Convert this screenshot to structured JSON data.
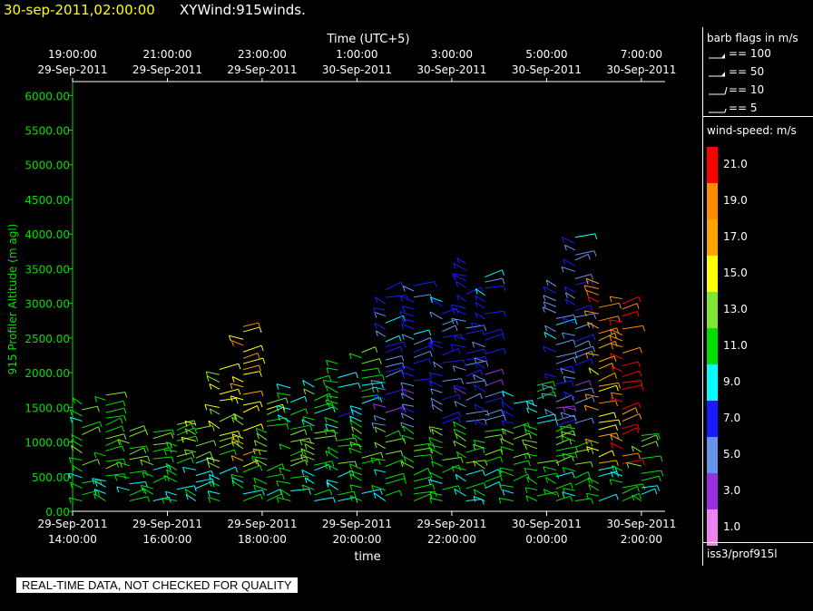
{
  "header": {
    "date_label": "30-sep-2011,02:00:00",
    "title": "XYWind:915winds."
  },
  "legend": {
    "barb_title": "barb flags in m/s",
    "barbs": [
      {
        "value": 100,
        "label": "== 100"
      },
      {
        "value": 50,
        "label": "== 50"
      },
      {
        "value": 10,
        "label": "== 10"
      },
      {
        "value": 5,
        "label": "== 5"
      }
    ],
    "speed_title": "wind-speed: m/s",
    "colorbar": [
      {
        "label": "21.0",
        "color": "#ff0000"
      },
      {
        "label": "19.0",
        "color": "#ff8c00"
      },
      {
        "label": "17.0",
        "color": "#ffa500"
      },
      {
        "label": "15.0",
        "color": "#ffff00"
      },
      {
        "label": "13.0",
        "color": "#7fe633"
      },
      {
        "label": "11.0",
        "color": "#00e000"
      },
      {
        "label": "9.0",
        "color": "#00ffff"
      },
      {
        "label": "7.0",
        "color": "#1a1aff"
      },
      {
        "label": "5.0",
        "color": "#6495ed"
      },
      {
        "label": "3.0",
        "color": "#9b30e0"
      },
      {
        "label": "1.0",
        "color": "#ee82ee"
      }
    ],
    "source": "iss3/prof915l"
  },
  "footer": {
    "quality_notice": "REAL-TIME DATA, NOT CHECKED FOR QUALITY"
  },
  "chart_data": {
    "type": "scatter",
    "subtype": "wind-barb time-height profile",
    "top_axis_title": "Time (UTC+5)",
    "xlabel": "time",
    "ylabel": "915 Profiler Altitude (m agl)",
    "x_range_hours": [
      14.0,
      26.5
    ],
    "ylim": [
      0,
      6200
    ],
    "y_ticks": [
      "0.00",
      "500.00",
      "1000.00",
      "1500.00",
      "2000.00",
      "2500.00",
      "3000.00",
      "3500.00",
      "4000.00",
      "4500.00",
      "5000.00",
      "5500.00",
      "6000.00"
    ],
    "x_ticks_bottom": [
      {
        "hour": 14,
        "line1": "29-Sep-2011",
        "line2": "14:00:00"
      },
      {
        "hour": 16,
        "line1": "29-Sep-2011",
        "line2": "16:00:00"
      },
      {
        "hour": 18,
        "line1": "29-Sep-2011",
        "line2": "18:00:00"
      },
      {
        "hour": 20,
        "line1": "29-Sep-2011",
        "line2": "20:00:00"
      },
      {
        "hour": 22,
        "line1": "29-Sep-2011",
        "line2": "22:00:00"
      },
      {
        "hour": 24,
        "line1": "30-Sep-2011",
        "line2": "0:00:00"
      },
      {
        "hour": 26,
        "line1": "30-Sep-2011",
        "line2": "2:00:00"
      }
    ],
    "x_ticks_top": [
      {
        "hour": 14,
        "line1": "19:00:00",
        "line2": "29-Sep-2011"
      },
      {
        "hour": 16,
        "line1": "21:00:00",
        "line2": "29-Sep-2011"
      },
      {
        "hour": 18,
        "line1": "23:00:00",
        "line2": "29-Sep-2011"
      },
      {
        "hour": 20,
        "line1": "1:00:00",
        "line2": "30-Sep-2011"
      },
      {
        "hour": 22,
        "line1": "3:00:00",
        "line2": "30-Sep-2011"
      },
      {
        "hour": 24,
        "line1": "5:00:00",
        "line2": "30-Sep-2011"
      },
      {
        "hour": 26,
        "line1": "7:00:00",
        "line2": "30-Sep-2011"
      }
    ],
    "axis_color": "#00e000",
    "profiles": [
      {
        "hour": 14.2,
        "top": 1600,
        "speed": 11
      },
      {
        "hour": 14.7,
        "top": 1700,
        "speed": 11
      },
      {
        "hour": 15.2,
        "top": 1250,
        "speed": 11
      },
      {
        "hour": 15.7,
        "top": 1200,
        "speed": 11
      },
      {
        "hour": 16.2,
        "top": 1300,
        "speed": 11
      },
      {
        "hour": 16.6,
        "top": 1300,
        "speed": 13
      },
      {
        "hour": 17.1,
        "top": 2100,
        "speed": 15
      },
      {
        "hour": 17.6,
        "top": 2700,
        "speed": 17
      },
      {
        "hour": 18.1,
        "top": 1600,
        "speed": 13
      },
      {
        "hour": 18.6,
        "top": 1800,
        "speed": 11
      },
      {
        "hour": 19.1,
        "top": 1900,
        "speed": 11
      },
      {
        "hour": 19.6,
        "top": 2200,
        "speed": 11
      },
      {
        "hour": 20.1,
        "top": 2400,
        "speed": 11
      },
      {
        "hour": 20.6,
        "top": 3200,
        "speed": 7
      },
      {
        "hour": 21.2,
        "top": 3300,
        "speed": 7
      },
      {
        "hour": 21.8,
        "top": 3100,
        "speed": 7
      },
      {
        "hour": 22.3,
        "top": 3600,
        "speed": 7
      },
      {
        "hour": 22.7,
        "top": 3400,
        "speed": 7
      },
      {
        "hour": 23.3,
        "top": 1700,
        "speed": 9
      },
      {
        "hour": 23.8,
        "top": 1900,
        "speed": 11
      },
      {
        "hour": 24.2,
        "top": 3300,
        "speed": 7
      },
      {
        "hour": 24.6,
        "top": 4000,
        "speed": 7
      },
      {
        "hour": 25.1,
        "top": 3300,
        "speed": 19
      },
      {
        "hour": 25.6,
        "top": 3100,
        "speed": 21
      },
      {
        "hour": 26.0,
        "top": 1100,
        "speed": 7
      }
    ]
  }
}
